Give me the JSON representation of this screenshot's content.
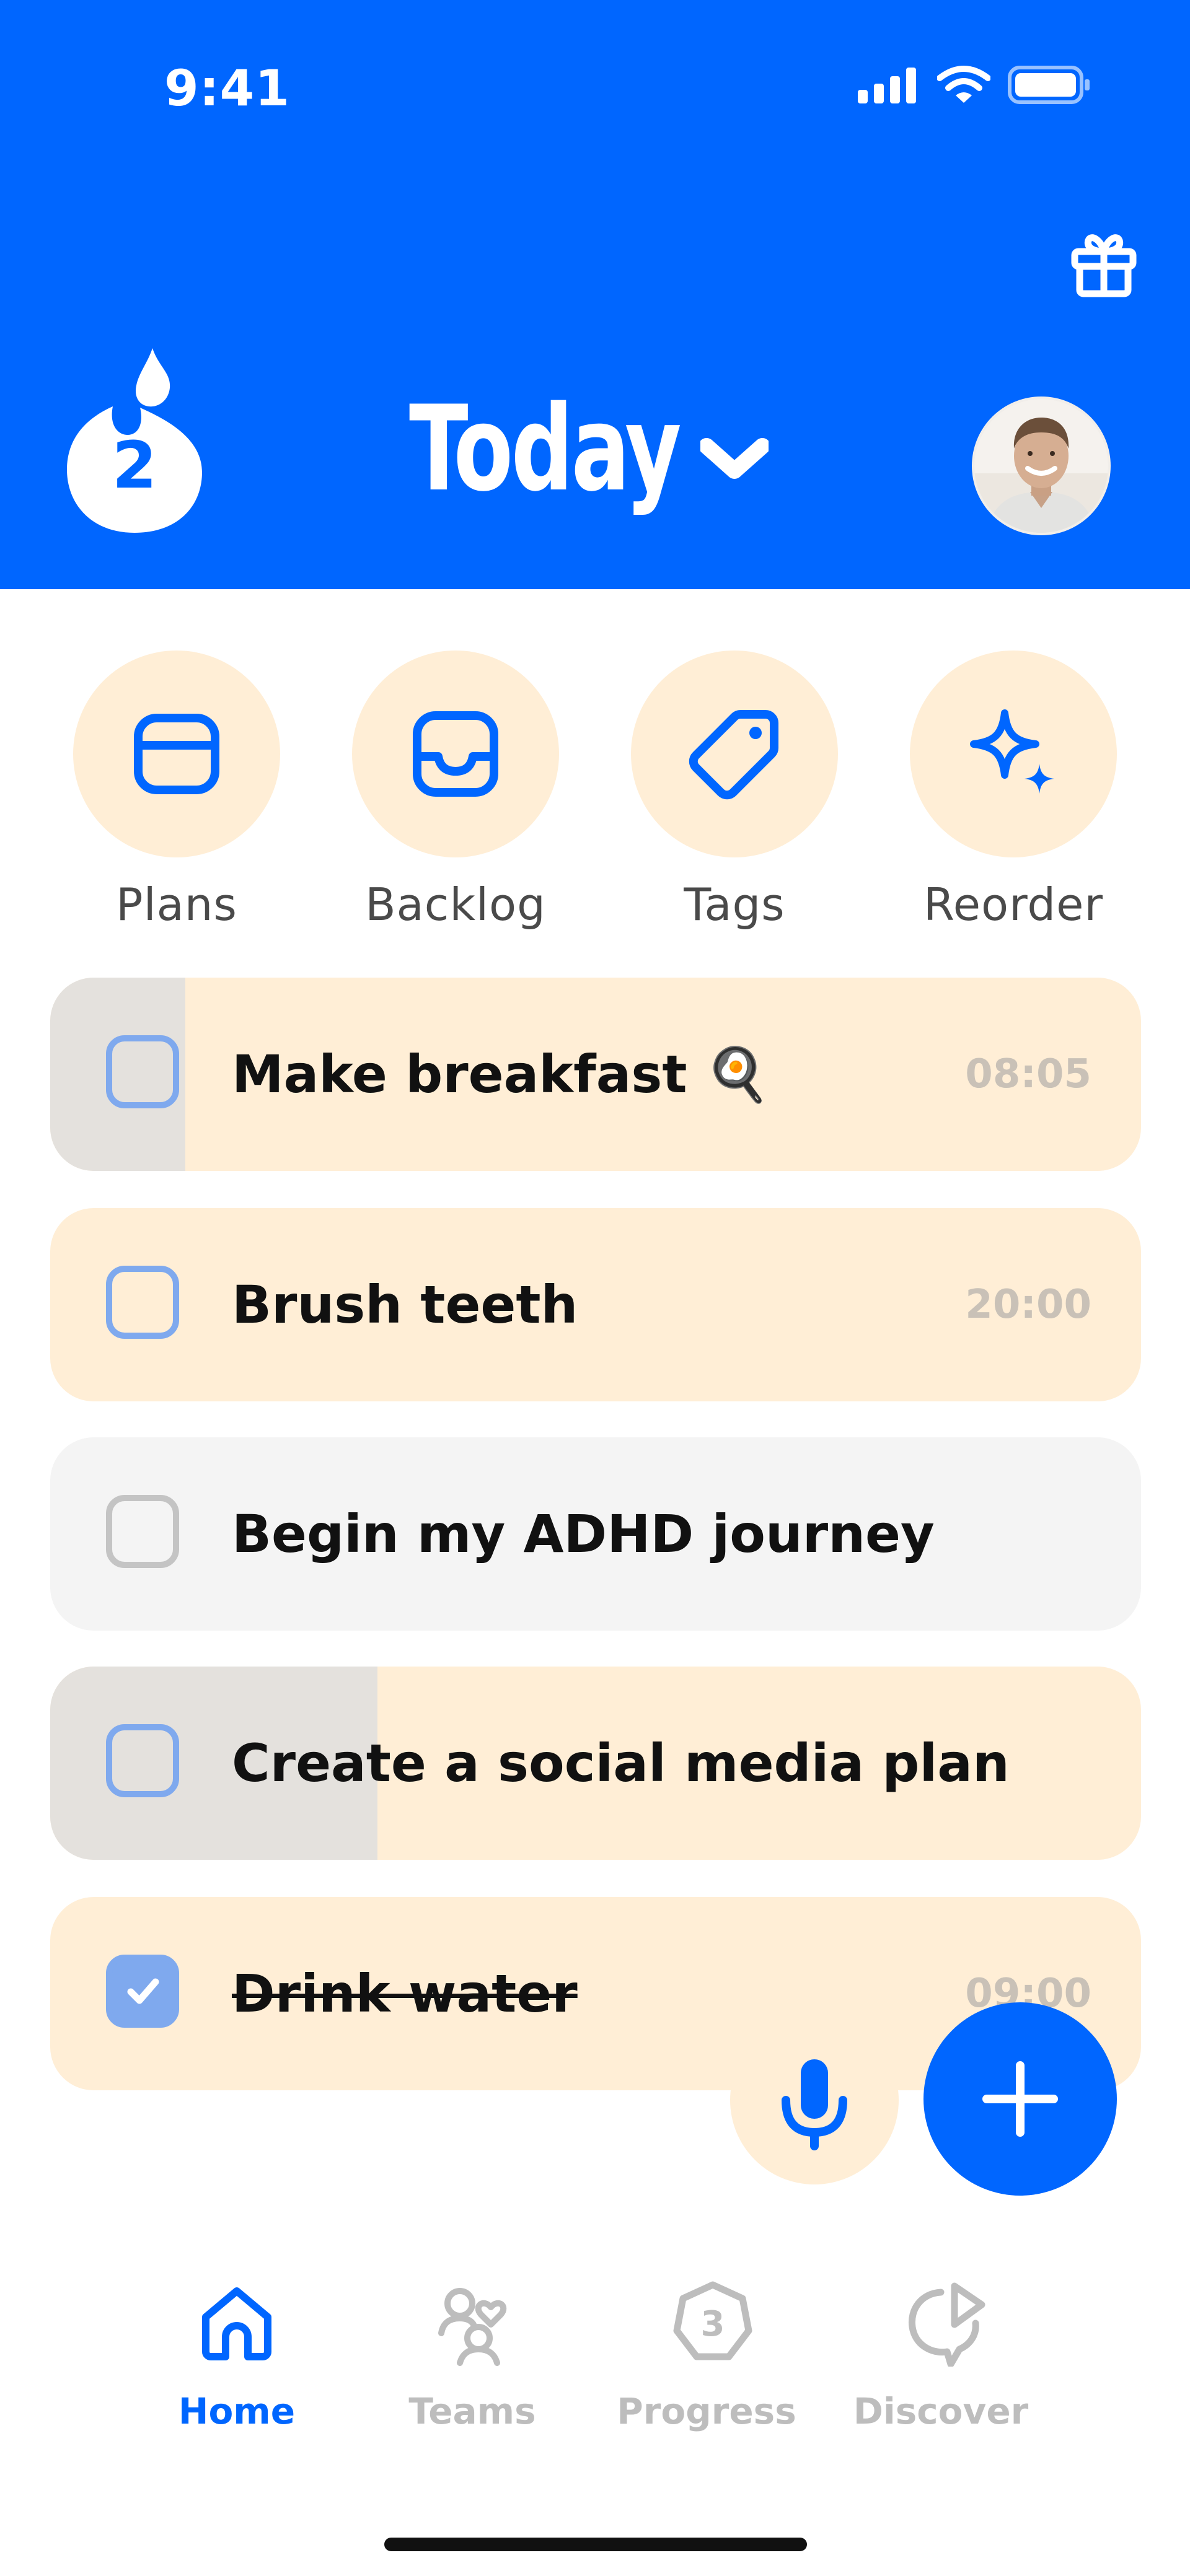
{
  "status_bar": {
    "time": "9:41"
  },
  "header": {
    "streak_count": "2",
    "title": "Today",
    "gift_icon": "gift-icon",
    "dropdown_icon": "chevron-down-icon",
    "colors": {
      "background": "#0066FF"
    }
  },
  "quick_actions": [
    {
      "label": "Plans",
      "icon": "calendar-icon"
    },
    {
      "label": "Backlog",
      "icon": "inbox-icon"
    },
    {
      "label": "Tags",
      "icon": "tag-icon"
    },
    {
      "label": "Reorder",
      "icon": "sparkles-icon"
    }
  ],
  "tasks": [
    {
      "title": "Make breakfast 🍳",
      "time": "08:05",
      "checked": false,
      "progress": 0.12
    },
    {
      "title": "Brush teeth",
      "time": "20:00",
      "checked": false,
      "progress": 0
    },
    {
      "title": "Begin my ADHD journey",
      "time": "",
      "checked": false,
      "progress": 0
    },
    {
      "title": "Create a social media plan",
      "time": "",
      "checked": false,
      "progress": 0.3
    },
    {
      "title": "Drink water",
      "time": "09:00",
      "checked": true,
      "progress": 0
    }
  ],
  "fab": {
    "mic_icon": "microphone-icon",
    "add_icon": "plus-icon"
  },
  "bottom_nav": [
    {
      "label": "Home",
      "icon": "home-icon",
      "active": true
    },
    {
      "label": "Teams",
      "icon": "teams-icon",
      "active": false
    },
    {
      "label": "Progress",
      "icon": "progress-badge-icon",
      "badge": "3",
      "active": false
    },
    {
      "label": "Discover",
      "icon": "discover-icon",
      "active": false
    }
  ],
  "colors": {
    "accent": "#0066FF",
    "card": "#FFEED6",
    "card_grey": "#F4F4F4",
    "checkbox": "#7FA9EE"
  }
}
